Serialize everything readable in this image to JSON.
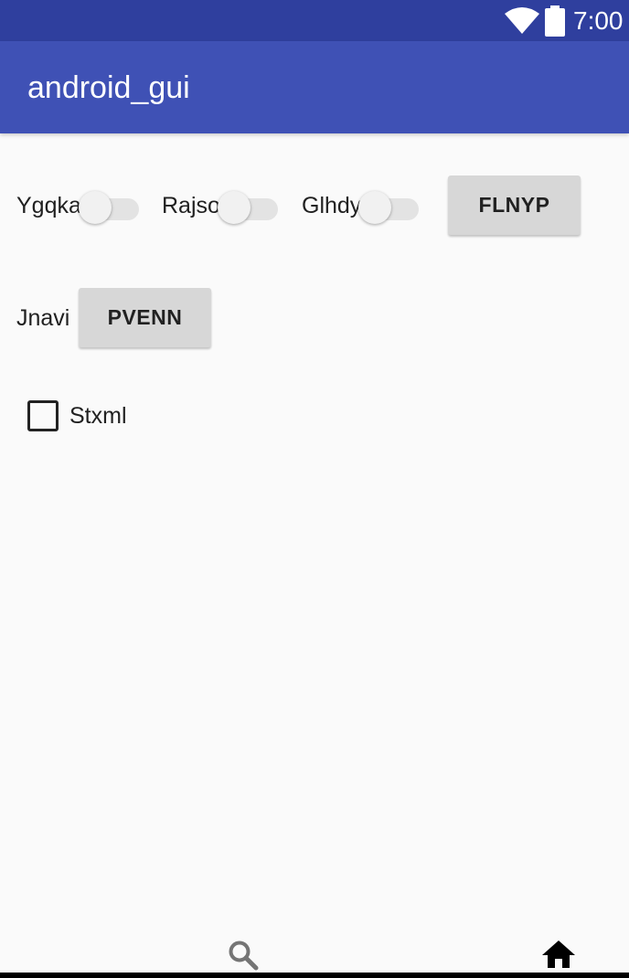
{
  "status_bar": {
    "time": "7:00",
    "icons": [
      "wifi-icon",
      "battery-icon"
    ]
  },
  "app_bar": {
    "title": "android_gui",
    "color": "#3f51b5"
  },
  "row1": {
    "switch1_label": "Ygqka",
    "switch1_on": false,
    "switch2_label": "Rajso",
    "switch2_on": false,
    "switch3_label": "Glhdy",
    "switch3_on": false,
    "button_label": "FLNYP"
  },
  "row2": {
    "label": "Jnavi",
    "button_label": "PVENN"
  },
  "checkbox": {
    "label": "Stxml",
    "checked": false
  },
  "bottom_nav": {
    "icons": [
      "search-icon",
      "home-icon"
    ]
  }
}
